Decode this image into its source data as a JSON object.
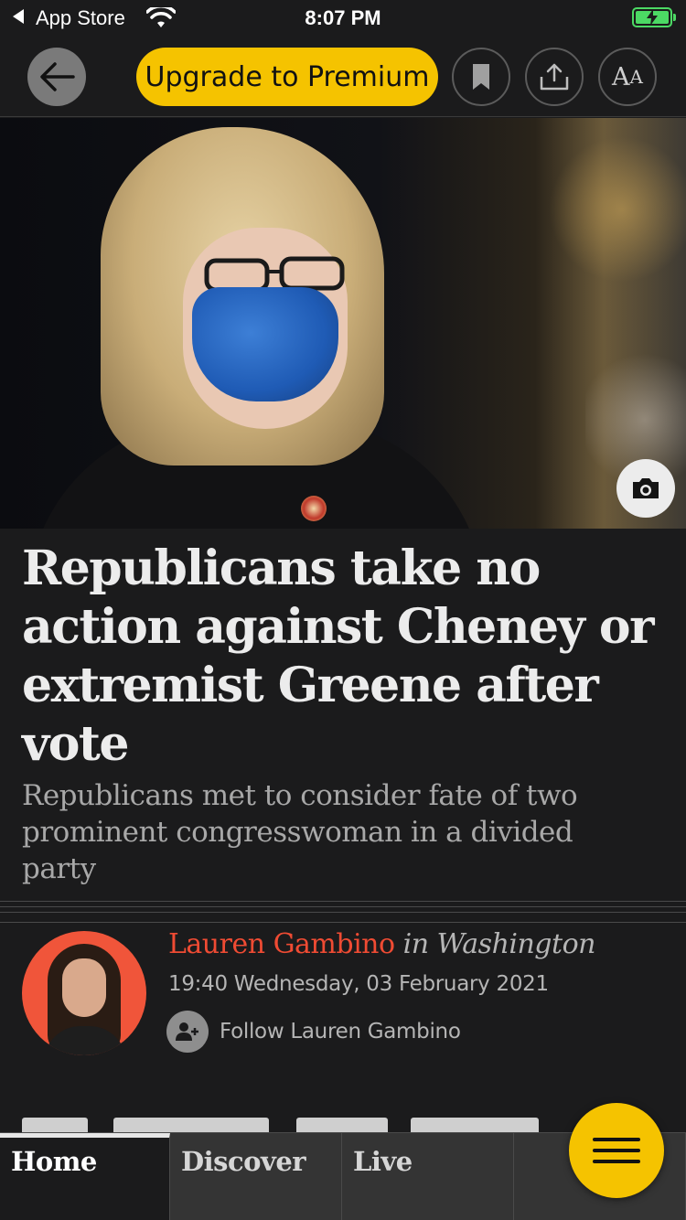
{
  "status_bar": {
    "back_app": "App Store",
    "time": "8:07 PM"
  },
  "toolbar": {
    "back_icon": "arrow-left-icon",
    "premium_label": "Upgrade to Premium",
    "bookmark_icon": "bookmark-icon",
    "share_icon": "share-icon",
    "text_size_big": "A",
    "text_size_small": "A"
  },
  "hero": {
    "camera_icon": "camera-icon"
  },
  "article": {
    "headline": "Republicans take no action against Cheney or extremist Greene after vote",
    "standfirst": "Republicans met to consider fate of two prominent congresswoman in a divided party",
    "author": "Lauren Gambino",
    "location": "in Washington",
    "dateline": "19:40 Wednesday, 03 February 2021",
    "follow_label": "Follow Lauren Gambino"
  },
  "tabs": [
    {
      "label": "Home",
      "active": true
    },
    {
      "label": "Discover",
      "active": false
    },
    {
      "label": "Live",
      "active": false
    }
  ],
  "menu_icon": "hamburger-menu-icon",
  "colors": {
    "accent_yellow": "#f5c300",
    "author_red": "#ef4b33",
    "background": "#1b1b1c"
  }
}
